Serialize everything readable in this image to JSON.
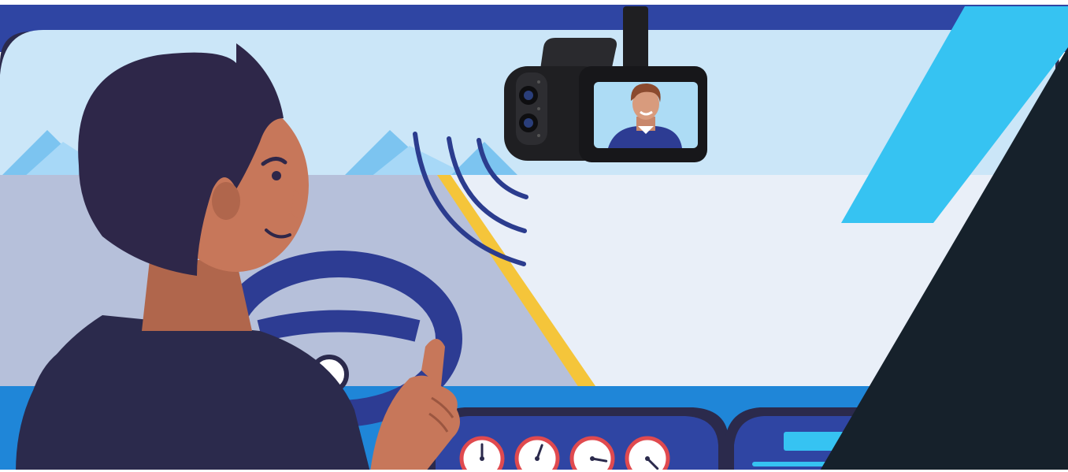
{
  "scene": {
    "subject": "driver-with-dash-camera",
    "icons": [
      "dash-camera-icon",
      "voice-wave-icon",
      "steering-wheel-icon",
      "speedometer-gauge-icon"
    ]
  },
  "gauges": {
    "count": 4,
    "needle_angles_deg": [
      0,
      20,
      100,
      135
    ]
  },
  "colors": {
    "frame_dark": "#2B2A4C",
    "frame_blue": "#2F45A3",
    "sky": "#CBE6F8",
    "road": "#B6C0DA",
    "road_right": "#E9EFF8",
    "lane_yellow": "#F5C53A",
    "skin": "#C7775A",
    "hair": "#2E2749",
    "seat_blue": "#2F86DA",
    "wheel_blue": "#2D3C93",
    "dash_blue": "#1F86D8",
    "camera_black": "#1F1F22",
    "panel_dark": "#16212B",
    "accent_cyan": "#36C3F2"
  }
}
